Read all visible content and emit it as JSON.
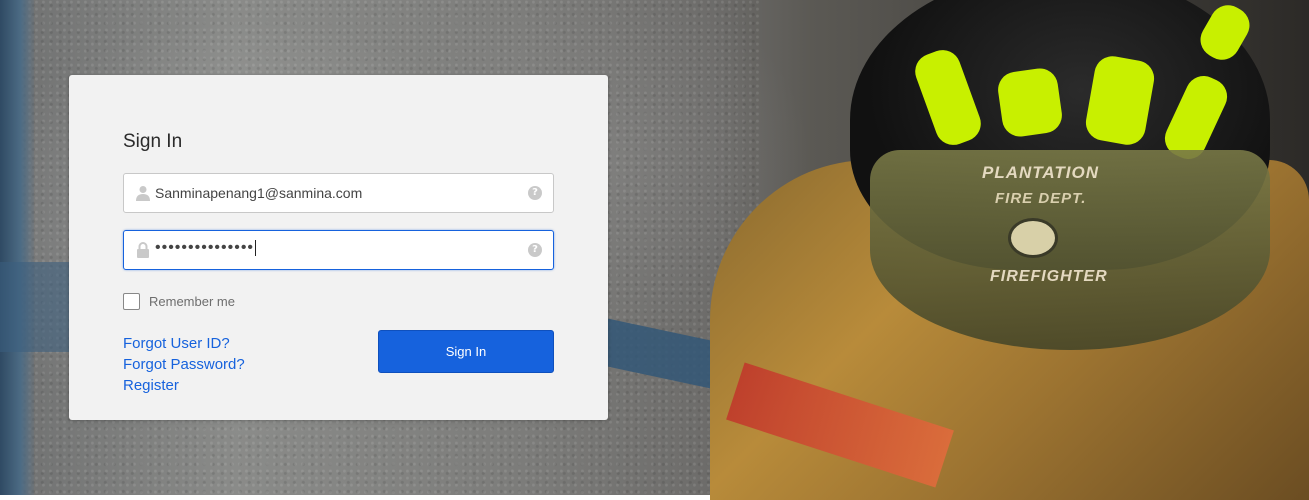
{
  "form": {
    "title": "Sign In",
    "username": {
      "value": "Sanminapenang1@sanmina.com",
      "icon": "person-icon",
      "help_icon": "help-circle-icon"
    },
    "password": {
      "masked_value": "•••••••••••••••",
      "icon": "lock-icon",
      "help_icon": "help-circle-icon"
    },
    "remember_me": {
      "label": "Remember me",
      "checked": false
    },
    "links": {
      "forgot_user_id": "Forgot User ID?",
      "forgot_password": "Forgot Password?",
      "register": "Register"
    },
    "submit_label": "Sign In"
  },
  "background": {
    "helmet_text": {
      "line1": "PLANTATION",
      "line2": "FIRE DEPT.",
      "line3": "FIREFIGHTER"
    }
  },
  "colors": {
    "primary": "#1662dd",
    "card_bg": "#f2f2f2"
  }
}
